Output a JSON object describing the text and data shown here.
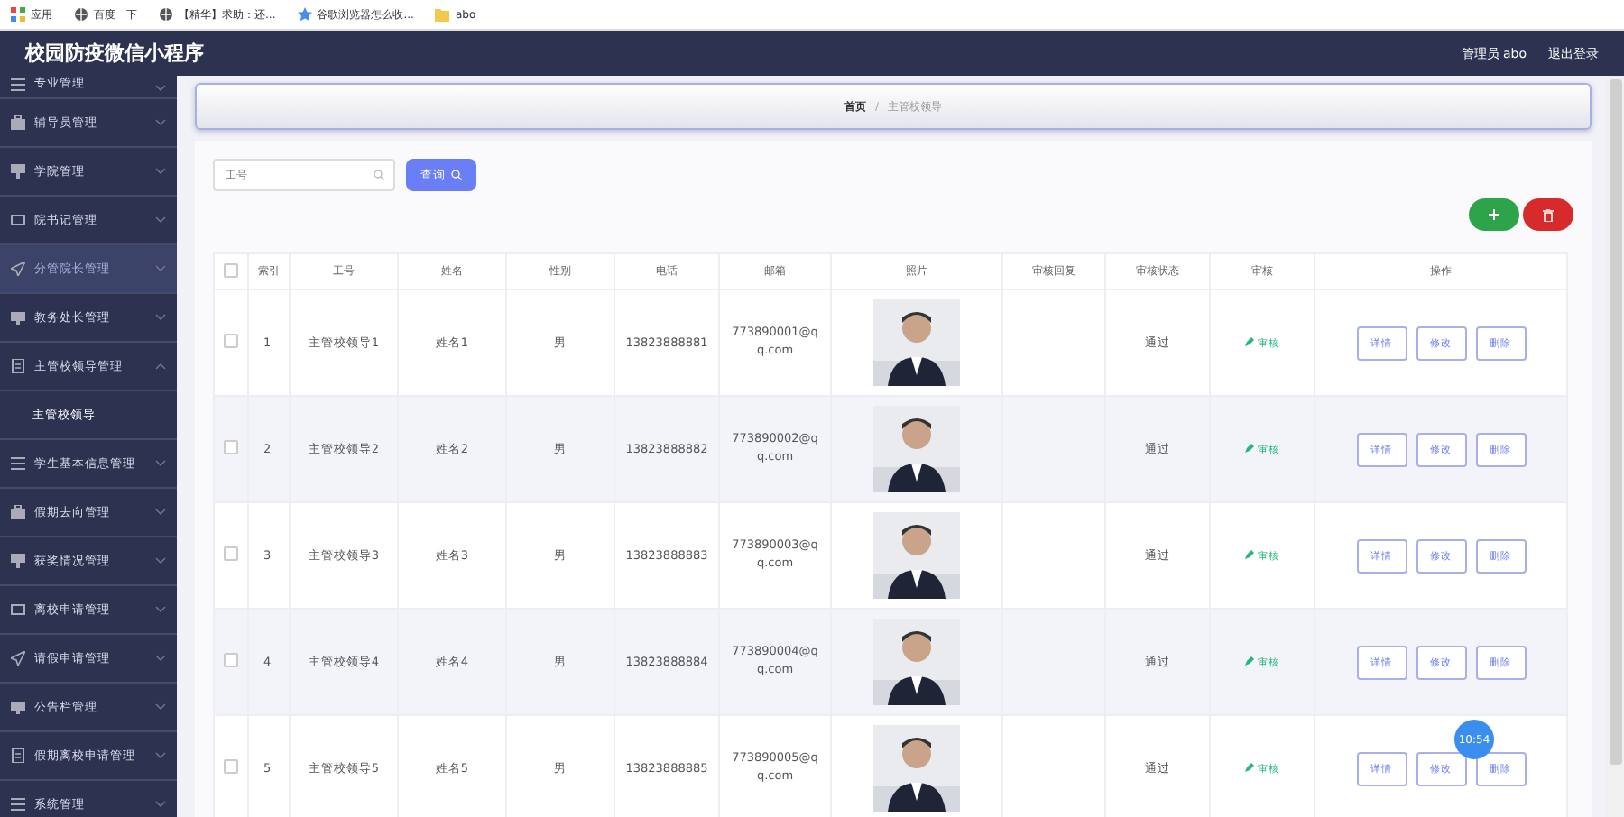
{
  "bookmarks": [
    {
      "label": "应用",
      "kind": "apps"
    },
    {
      "label": "百度一下",
      "kind": "globe"
    },
    {
      "label": "【精华】求助：还...",
      "kind": "globe"
    },
    {
      "label": "谷歌浏览器怎么收...",
      "kind": "star"
    },
    {
      "label": "abo",
      "kind": "folder"
    }
  ],
  "header": {
    "title": "校园防疫微信小程序",
    "user": "管理员 abo",
    "logout": "退出登录"
  },
  "sidebar": {
    "items": [
      {
        "label": "专业管理",
        "expanded": false,
        "hover": false
      },
      {
        "label": "辅导员管理",
        "expanded": false,
        "hover": false
      },
      {
        "label": "学院管理",
        "expanded": false,
        "hover": false
      },
      {
        "label": "院书记管理",
        "expanded": false,
        "hover": false
      },
      {
        "label": "分管院长管理",
        "expanded": false,
        "hover": true
      },
      {
        "label": "教务处长管理",
        "expanded": false,
        "hover": false
      },
      {
        "label": "主管校领导管理",
        "expanded": true,
        "hover": false,
        "children": [
          {
            "label": "主管校领导"
          }
        ]
      },
      {
        "label": "学生基本信息管理",
        "expanded": false,
        "hover": false
      },
      {
        "label": "假期去向管理",
        "expanded": false,
        "hover": false
      },
      {
        "label": "获奖情况管理",
        "expanded": false,
        "hover": false
      },
      {
        "label": "离校申请管理",
        "expanded": false,
        "hover": false
      },
      {
        "label": "请假申请管理",
        "expanded": false,
        "hover": false
      },
      {
        "label": "公告栏管理",
        "expanded": false,
        "hover": false
      },
      {
        "label": "假期离校申请管理",
        "expanded": false,
        "hover": false
      },
      {
        "label": "系统管理",
        "expanded": false,
        "hover": false
      }
    ]
  },
  "breadcrumb": [
    "首页",
    "/",
    "主管校领导"
  ],
  "search": {
    "placeholder": "工号",
    "button": "查询"
  },
  "table": {
    "select_all_checked": false,
    "columns": [
      "",
      "索引",
      "工号",
      "姓名",
      "性别",
      "电话",
      "邮箱",
      "照片",
      "审核回复",
      "审核状态",
      "审核",
      "操作"
    ],
    "rows": [
      {
        "checked": false,
        "index": "1",
        "id": "主管校领导1",
        "name": "姓名1",
        "gender": "男",
        "phone": "13823888881",
        "email": "773890001@qq.com",
        "status": "通过",
        "audit": "审核",
        "actions": [
          "详情",
          "修改",
          "删除"
        ]
      },
      {
        "checked": false,
        "index": "2",
        "id": "主管校领导2",
        "name": "姓名2",
        "gender": "男",
        "phone": "13823888882",
        "email": "773890002@qq.com",
        "status": "通过",
        "audit": "审核",
        "actions": [
          "详情",
          "修改",
          "删除"
        ]
      },
      {
        "checked": false,
        "index": "3",
        "id": "主管校领导3",
        "name": "姓名3",
        "gender": "男",
        "phone": "13823888883",
        "email": "773890003@qq.com",
        "status": "通过",
        "audit": "审核",
        "actions": [
          "详情",
          "修改",
          "删除"
        ]
      },
      {
        "checked": false,
        "index": "4",
        "id": "主管校领导4",
        "name": "姓名4",
        "gender": "男",
        "phone": "13823888884",
        "email": "773890004@qq.com",
        "status": "通过",
        "audit": "审核",
        "actions": [
          "详情",
          "修改",
          "删除"
        ]
      },
      {
        "checked": false,
        "index": "5",
        "id": "主管校领导5",
        "name": "姓名5",
        "gender": "男",
        "phone": "13823888885",
        "email": "773890005@qq.com",
        "status": "通过",
        "audit": "审核",
        "actions": [
          "详情",
          "修改",
          "删除"
        ]
      }
    ]
  },
  "clock": "10:54"
}
